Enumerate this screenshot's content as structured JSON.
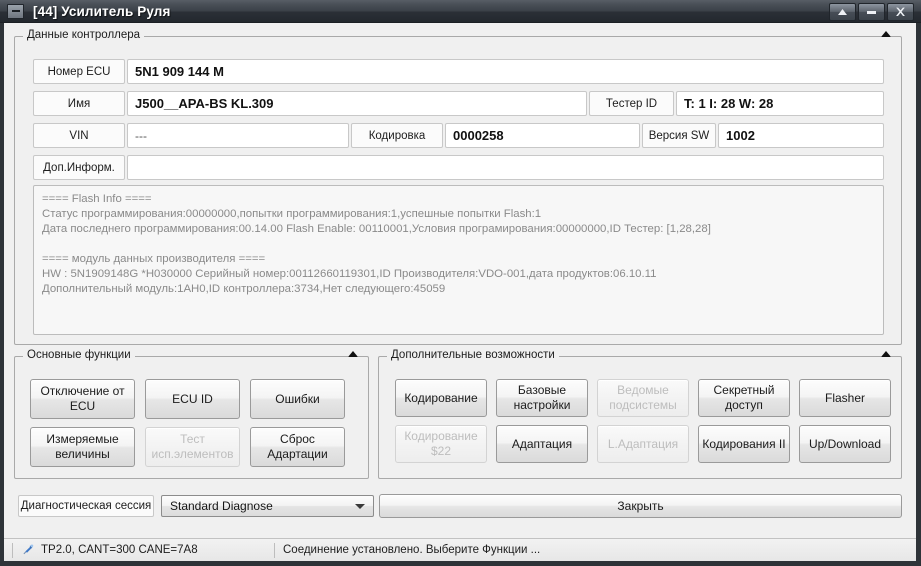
{
  "window": {
    "title": "[44] Усилитель Руля",
    "sysmenu_icon": "window-menu-icon",
    "controls": [
      {
        "name": "restore-button",
        "icon": "triangle-up-icon"
      },
      {
        "name": "minimize-button",
        "icon": "minus-icon"
      },
      {
        "name": "close-button",
        "icon": "close-x-icon"
      }
    ]
  },
  "controller_data": {
    "legend": "Данные контроллера",
    "fields": {
      "ecu_number_label": "Номер ECU",
      "ecu_number_value": "5N1 909 144 M",
      "name_label": "Имя",
      "name_value": "J500__APA-BS KL.309",
      "tester_id_label": "Тестер ID",
      "tester_id_value": "T: 1 I: 28 W: 28",
      "vin_label": "VIN",
      "vin_value": "---",
      "coding_label": "Кодировка",
      "coding_value": "0000258",
      "sw_version_label": "Версия SW",
      "sw_version_value": "1002",
      "extra_info_label": "Доп.Информ.",
      "extra_info_value": ""
    },
    "info_lines": [
      "==== Flash Info ====",
      "Статус программирования:00000000,попытки программирования:1,успешные попытки Flash:1",
      "Дата последнего программирования:00.14.00 Flash Enable: 00110001,Условия програмирования:00000000,ID Тестер: [1,28,28]",
      "",
      "==== модуль данных производителя ====",
      "HW : 5N1909148G  *H030000 Серийный номер:00112660119301,ID Производителя:VDO-001,дата продуктов:06.10.11",
      "Дополнительный модуль:1AH0,ID контроллера:3734,Нет следующего:45059"
    ]
  },
  "main_functions": {
    "legend": "Основные функции",
    "buttons": [
      {
        "label": "Отключение от ECU",
        "enabled": true
      },
      {
        "label": "ECU ID",
        "enabled": true
      },
      {
        "label": "Ошибки",
        "enabled": true
      },
      {
        "label": "Измеряемые величины",
        "enabled": true
      },
      {
        "label": "Тест исп.элементов",
        "enabled": false
      },
      {
        "label": "Сброс Адартации",
        "enabled": true
      }
    ]
  },
  "extra_functions": {
    "legend": "Дополнительные возможности",
    "buttons": [
      {
        "label": "Кодирование",
        "enabled": true
      },
      {
        "label": "Базовые настройки",
        "enabled": true
      },
      {
        "label": "Ведомые подсистемы",
        "enabled": false
      },
      {
        "label": "Секретный доступ",
        "enabled": true
      },
      {
        "label": "Flasher",
        "enabled": true
      },
      {
        "label": "Кодирование $22",
        "enabled": false
      },
      {
        "label": "Адаптация",
        "enabled": true
      },
      {
        "label": "L.Адаптация",
        "enabled": false
      },
      {
        "label": "Кодирования II",
        "enabled": true
      },
      {
        "label": "Up/Download",
        "enabled": true
      }
    ]
  },
  "footer": {
    "session_label": "Диагностическая сессия",
    "session_value": "Standard Diagnose",
    "close_label": "Закрыть"
  },
  "statusbar": {
    "connection_icon": "plug-connector-icon",
    "protocol_text": "TP2.0, CANT=300 CANE=7A8",
    "message_text": "Соединение установлено. Выберите Функции ..."
  }
}
